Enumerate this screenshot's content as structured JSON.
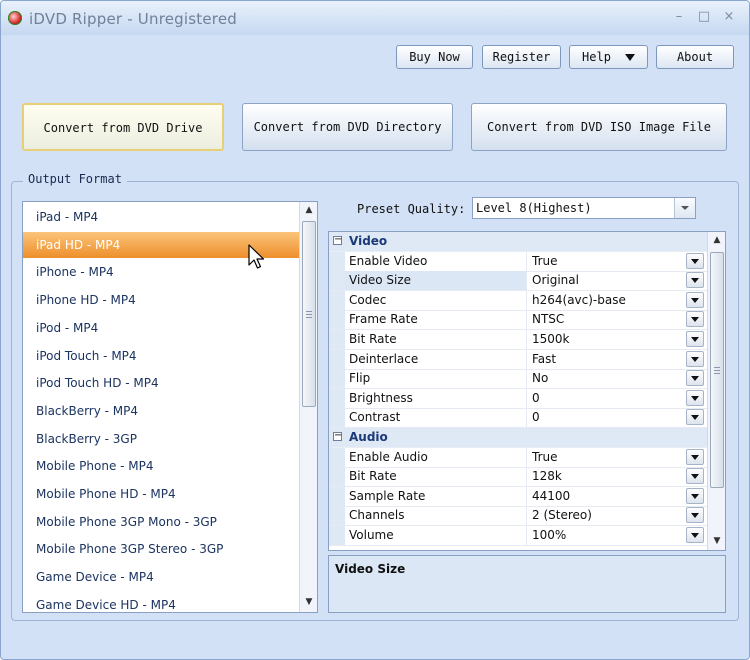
{
  "window": {
    "title": "iDVD Ripper - Unregistered",
    "minimize": "–",
    "maximize": "□",
    "close": "×"
  },
  "toolbar": {
    "buy_now": "Buy Now",
    "register": "Register",
    "help": "Help",
    "about": "About"
  },
  "convert": {
    "dvd_drive": "Convert from DVD Drive",
    "dvd_directory": "Convert from DVD Directory",
    "iso_file": "Convert from DVD ISO Image File"
  },
  "output_format": {
    "label": "Output Format",
    "selected_index": 1,
    "items": [
      "iPad - MP4",
      "iPad HD - MP4",
      "iPhone - MP4",
      "iPhone HD - MP4",
      "iPod - MP4",
      "iPod Touch - MP4",
      "iPod Touch HD - MP4",
      "BlackBerry - MP4",
      "BlackBerry - 3GP",
      "Mobile Phone - MP4",
      "Mobile Phone HD - MP4",
      "Mobile Phone 3GP Mono - 3GP",
      "Mobile Phone 3GP Stereo - 3GP",
      "Game Device - MP4",
      "Game Device HD - MP4"
    ]
  },
  "preset": {
    "label": "Preset Quality:",
    "value": "Level 8(Highest)"
  },
  "properties": {
    "video": {
      "label": "Video",
      "rows": [
        {
          "name": "Enable Video",
          "value": "True"
        },
        {
          "name": "Video Size",
          "value": "Original"
        },
        {
          "name": "Codec",
          "value": "h264(avc)-base"
        },
        {
          "name": "Frame Rate",
          "value": "NTSC"
        },
        {
          "name": "Bit Rate",
          "value": "1500k"
        },
        {
          "name": "Deinterlace",
          "value": "Fast"
        },
        {
          "name": "Flip",
          "value": "No"
        },
        {
          "name": "Brightness",
          "value": "0"
        },
        {
          "name": "Contrast",
          "value": "0"
        }
      ]
    },
    "audio": {
      "label": "Audio",
      "rows": [
        {
          "name": "Enable Audio",
          "value": "True"
        },
        {
          "name": "Bit Rate",
          "value": "128k"
        },
        {
          "name": "Sample Rate",
          "value": "44100"
        },
        {
          "name": "Channels",
          "value": "2 (Stereo)"
        },
        {
          "name": "Volume",
          "value": "100%"
        }
      ]
    },
    "selected_property": "Video Size"
  },
  "description": {
    "title": "Video Size"
  },
  "colors": {
    "selection": "#ee8f2b",
    "window_bg": "#d2e1f5",
    "category_text": "#1b3a78"
  }
}
